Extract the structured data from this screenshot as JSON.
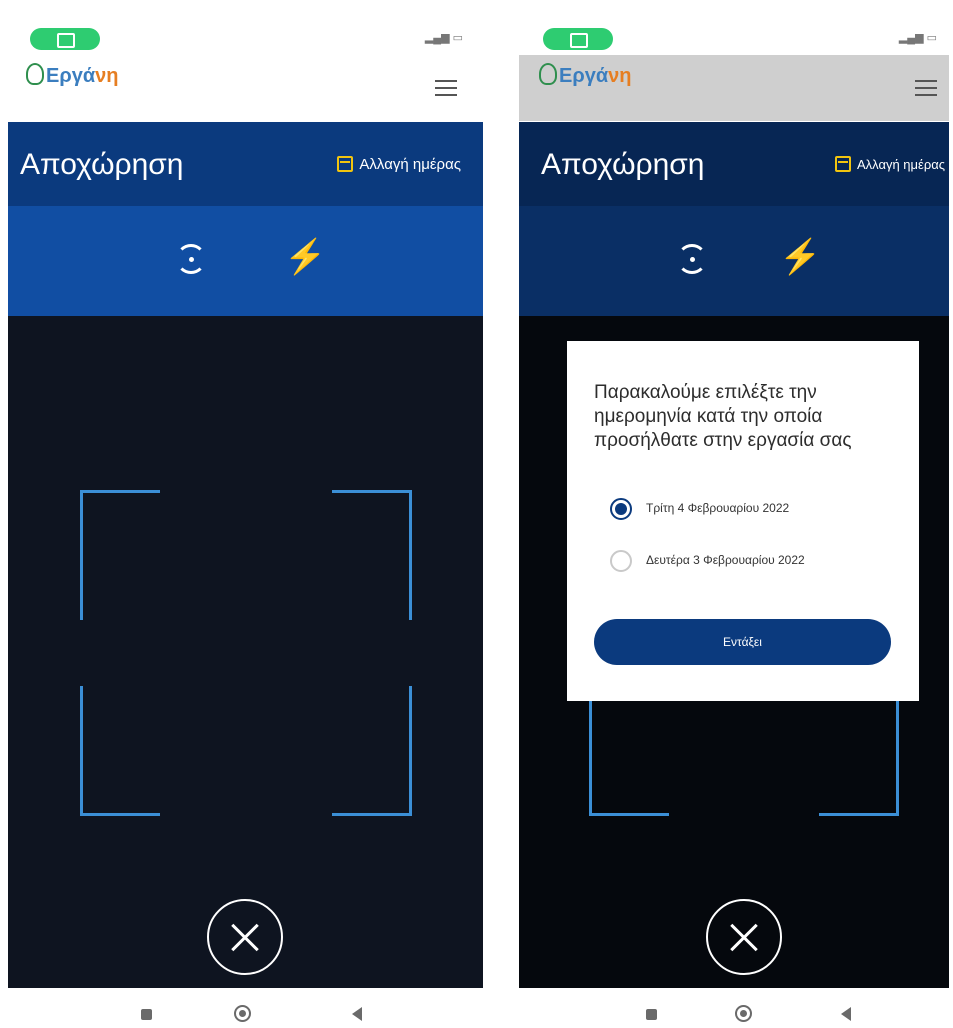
{
  "app": {
    "logo_prefix": "Εργά",
    "logo_suffix": "νη"
  },
  "header": {
    "title": "Αποχώρηση",
    "change_day": "Αλλαγή ημέρας"
  },
  "icons": [
    "calendar-icon",
    "rotate-camera-icon",
    "flash-icon",
    "close-icon",
    "menu-icon"
  ],
  "dialog": {
    "message": "Παρακαλούμε επιλέξτε την ημερομηνία κατά την οποία προσήλθατε στην εργασία σας",
    "options": [
      {
        "label": "Τρίτη 4 Φεβρουαρίου 2022",
        "selected": true
      },
      {
        "label": "Δευτέρα 3 Φεβρουαρίου 2022",
        "selected": false
      }
    ],
    "confirm": "Εντάξει"
  },
  "colors": {
    "primary": "#0b3a7e",
    "toolbar": "#114ea3",
    "frame": "#3b8fd6",
    "accent_icon": "#f1c40f"
  }
}
